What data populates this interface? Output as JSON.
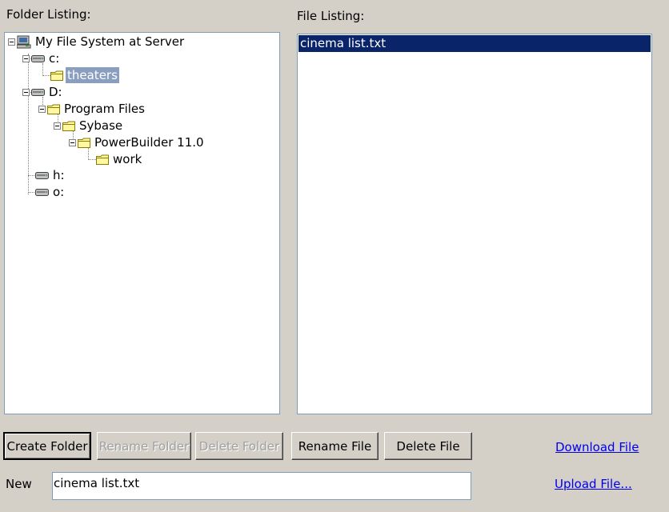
{
  "folder_panel": {
    "label": "Folder Listing:"
  },
  "file_panel": {
    "label": "File Listing:"
  },
  "tree": {
    "root": "My File System at Server",
    "drive_c": "c:",
    "theaters": "theaters",
    "drive_d": "D:",
    "program_files": "Program Files",
    "sybase": "Sybase",
    "powerbuilder": "PowerBuilder 11.0",
    "work": "work",
    "drive_h": "h:",
    "drive_o": "o:"
  },
  "files": [
    "cinema list.txt"
  ],
  "buttons": {
    "create_folder": "Create Folder",
    "rename_folder": "Rename Folder",
    "delete_folder": "Delete Folder",
    "rename_file": "Rename File",
    "delete_file": "Delete File"
  },
  "links": {
    "download": "Download File",
    "upload": "Upload File..."
  },
  "new_name": {
    "label": "New",
    "value": "cinema list.txt"
  },
  "colors": {
    "background": "#d4d0c8",
    "selection": "#0a246a",
    "tree_selection": "#8a9fbf",
    "link": "#0000ee"
  }
}
